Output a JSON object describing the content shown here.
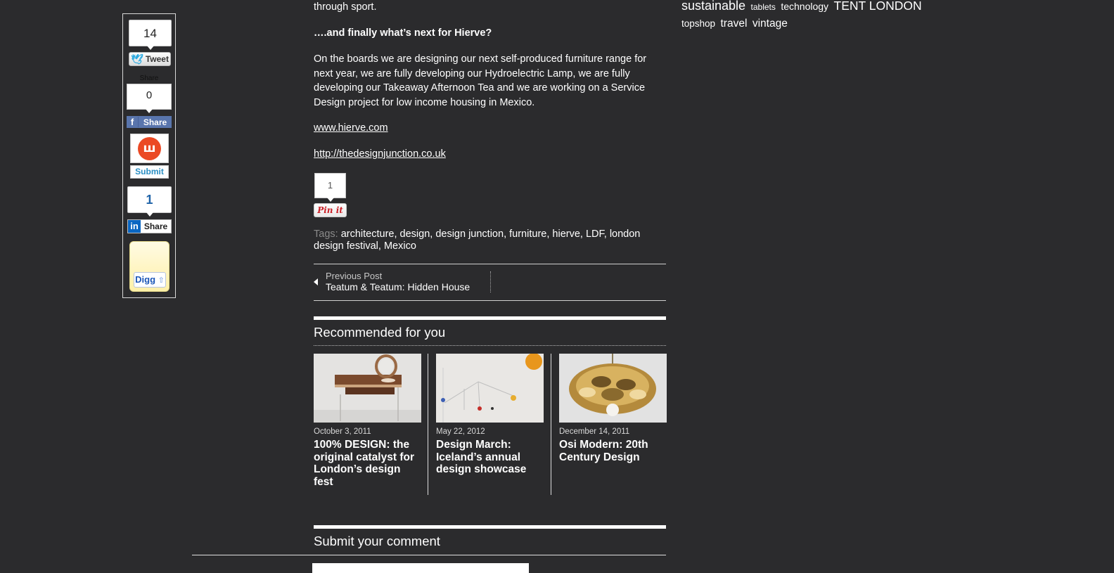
{
  "share": {
    "twitter": {
      "count": "14",
      "label": "Tweet",
      "icon": "twitter-bird-icon"
    },
    "facebook": {
      "tiny_label": "Share",
      "count": "0",
      "label": "Share",
      "icon": "facebook-f-icon"
    },
    "stumbleupon": {
      "label": "Submit",
      "icon": "stumbleupon-icon"
    },
    "linkedin": {
      "count": "1",
      "label": "Share",
      "icon": "linkedin-in-icon",
      "icon_text": "in"
    },
    "digg": {
      "label": "Digg",
      "icon": "digg-icon"
    }
  },
  "article": {
    "partial_line": "through sport.",
    "question": "….and finally what’s next for Hierve?",
    "paragraph": "On the boards we are designing our next self-produced furniture range for next year, we are fully developing our Hydroelectric Lamp, we are fully developing our Takeaway Afternoon Tea and we are working on a Service Design project for low income housing in Mexico.",
    "link1": "www.hierve.com",
    "link2": "http://thedesignjunction.co.uk"
  },
  "pinterest": {
    "count": "1",
    "label": "Pin it"
  },
  "tags": {
    "label": "Tags:",
    "items": [
      "architecture",
      "design",
      "design junction",
      "furniture",
      "hierve",
      "LDF",
      "london design festival",
      "Mexico"
    ]
  },
  "post_nav": {
    "kicker": "Previous Post",
    "title": "Teatum & Teatum: Hidden House"
  },
  "recommended": {
    "heading": "Recommended for you",
    "items": [
      {
        "date": "October 3, 2011",
        "title": "100% DESIGN: the original catalyst for London’s design fest"
      },
      {
        "date": "May 22, 2012",
        "title": "Design March: Iceland’s annual design showcase"
      },
      {
        "date": "December 14, 2011",
        "title": "Osi Modern: 20th Century Design"
      }
    ]
  },
  "comment": {
    "heading": "Submit your comment"
  },
  "tag_cloud": [
    {
      "label": "sustainable",
      "size": "l"
    },
    {
      "label": "tablets",
      "size": "s"
    },
    {
      "label": "technology",
      "size": "m"
    },
    {
      "label": "TENT LONDON",
      "size": "l"
    },
    {
      "label": "topshop",
      "size": "m"
    },
    {
      "label": "travel",
      "size": "ml"
    },
    {
      "label": "vintage",
      "size": "ml"
    }
  ]
}
